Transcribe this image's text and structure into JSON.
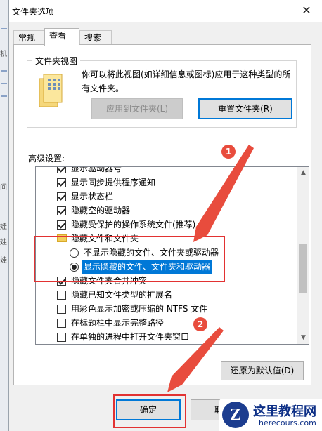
{
  "window": {
    "title": "文件夹选项",
    "close_icon": "close-icon"
  },
  "tabs": [
    {
      "label": "常规"
    },
    {
      "label": "查看",
      "active": true
    },
    {
      "label": "搜索"
    }
  ],
  "folder_views": {
    "label": "文件夹视图",
    "description": "你可以将此视图(如详细信息或图标)应用于这种类型的所有文件夹。",
    "apply_button": "应用到文件夹(L)",
    "reset_button": "重置文件夹(R)"
  },
  "advanced": {
    "label": "高级设置:",
    "items": [
      {
        "type": "checkbox",
        "checked": true,
        "label": "显示驱动器号"
      },
      {
        "type": "checkbox",
        "checked": true,
        "label": "显示同步提供程序通知"
      },
      {
        "type": "checkbox",
        "checked": true,
        "label": "显示状态栏"
      },
      {
        "type": "checkbox",
        "checked": true,
        "label": "隐藏空的驱动器"
      },
      {
        "type": "checkbox",
        "checked": true,
        "label": "隐藏受保护的操作系统文件(推荐)"
      },
      {
        "type": "folder",
        "label": "隐藏文件和文件夹"
      },
      {
        "type": "radio",
        "checked": false,
        "label": "不显示隐藏的文件、文件夹或驱动器"
      },
      {
        "type": "radio",
        "checked": true,
        "selected": true,
        "label": "显示隐藏的文件、文件夹和驱动器"
      },
      {
        "type": "checkbox",
        "checked": true,
        "label": "隐藏文件夹合并冲突"
      },
      {
        "type": "checkbox",
        "checked": false,
        "label": "隐藏已知文件类型的扩展名"
      },
      {
        "type": "checkbox",
        "checked": false,
        "label": "用彩色显示加密或压缩的 NTFS 文件"
      },
      {
        "type": "checkbox",
        "checked": false,
        "label": "在标题栏中显示完整路径"
      },
      {
        "type": "checkbox",
        "checked": false,
        "label": "在单独的进程中打开文件夹窗口"
      }
    ],
    "restore_button": "还原为默认值(D)",
    "scroll_position": 0.62
  },
  "footer": {
    "ok_button": "确定",
    "cancel_button": "取消"
  },
  "annotations": {
    "step1": "1",
    "step2": "2",
    "highlight_color": "#e23232"
  },
  "watermark": {
    "logo_letter": "Z",
    "name": "这里教程网",
    "url": "herecours.com"
  },
  "left_strip_marks": [
    "机",
    "间",
    "娃",
    "娃",
    "娃"
  ]
}
